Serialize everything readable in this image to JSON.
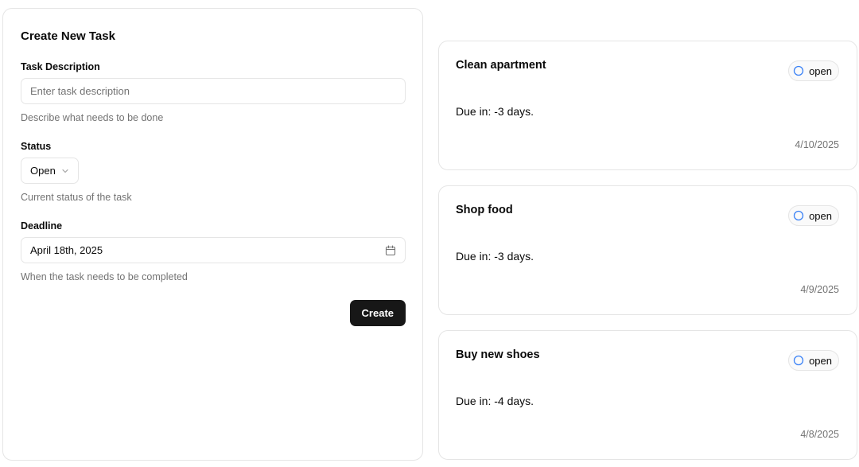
{
  "form": {
    "title": "Create New Task",
    "description": {
      "label": "Task Description",
      "placeholder": "Enter task description",
      "value": "",
      "helper": "Describe what needs to be done"
    },
    "status": {
      "label": "Status",
      "selected": "Open",
      "helper": "Current status of the task"
    },
    "deadline": {
      "label": "Deadline",
      "value": "April 18th, 2025",
      "helper": "When the task needs to be completed"
    },
    "create_label": "Create"
  },
  "tasks": [
    {
      "title": "Clean apartment",
      "status": "open",
      "due": "Due in: -3 days.",
      "date": "4/10/2025"
    },
    {
      "title": "Shop food",
      "status": "open",
      "due": "Due in: -3 days.",
      "date": "4/9/2025"
    },
    {
      "title": "Buy new shoes",
      "status": "open",
      "due": "Due in: -4 days.",
      "date": "4/8/2025"
    }
  ],
  "icons": {
    "status_select": "chevron-down-icon",
    "deadline_picker": "calendar-icon",
    "task_status": "circle-icon"
  },
  "colors": {
    "primary_button": "#171717",
    "status_circle": "#3b82f6",
    "muted_text": "#737373",
    "border": "#e5e5e5"
  }
}
